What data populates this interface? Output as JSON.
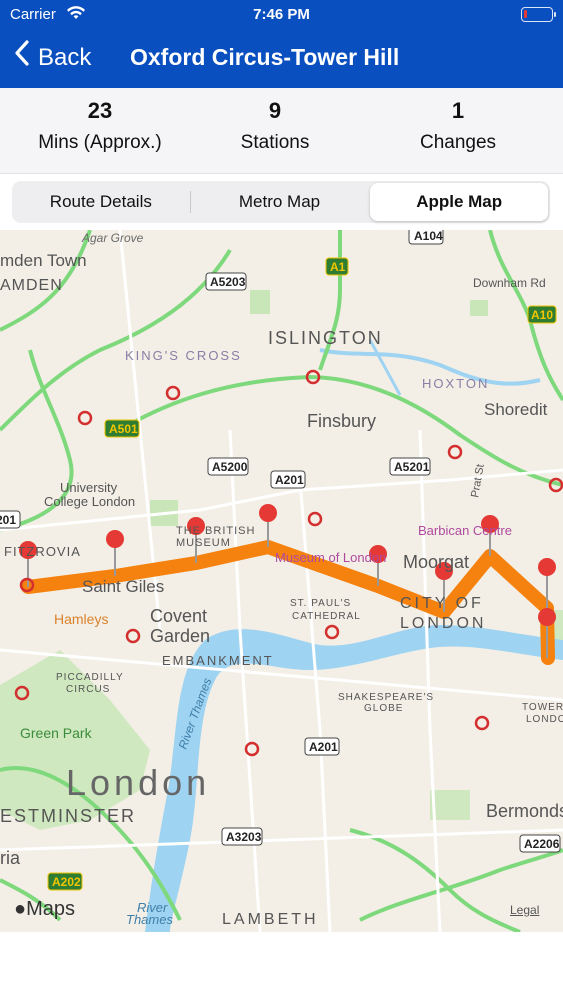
{
  "status": {
    "carrier": "Carrier",
    "time": "7:46 PM"
  },
  "nav": {
    "back_label": "Back",
    "title": "Oxford Circus-Tower Hill"
  },
  "stats": [
    {
      "value": "23",
      "label": "Mins (Approx.)"
    },
    {
      "value": "9",
      "label": "Stations"
    },
    {
      "value": "1",
      "label": "Changes"
    }
  ],
  "tabs": [
    {
      "label": "Route Details"
    },
    {
      "label": "Metro Map"
    },
    {
      "label": "Apple Map",
      "active": true
    }
  ],
  "map": {
    "places": [
      "mden Town",
      "AMDEN",
      "ISLINGTON",
      "KING'S CROSS",
      "HOXTON",
      "Shoredit",
      "Finsbury",
      "University",
      "College London",
      "THE BRITISH",
      "MUSEUM",
      "Barbican Centre",
      "FITZROVIA",
      "Saint Giles",
      "Museum of London",
      "Moorgat",
      "CITY OF",
      "LONDON",
      "ST. PAUL'S",
      "CATHEDRAL",
      "Hamleys",
      "Covent",
      "Garden",
      "EMBANKMENT",
      "PICCADILLY",
      "CIRCUS",
      "SHAKESPEARE'S",
      "GLOBE",
      "TOWER OF",
      "LONDON",
      "Green Park",
      "London",
      "ESTMINSTER",
      "Bermondse",
      "ria",
      "LAMBETH",
      "River Thames",
      "River",
      "Thames",
      "Agar Grove",
      "Downham Rd",
      "Prat St"
    ],
    "roads": [
      "A104",
      "A5203",
      "A1",
      "A10",
      "A501",
      "A5200",
      "A201",
      "A5201",
      "201",
      "A201",
      "A3203",
      "A2206",
      "A202"
    ],
    "attribution": "Maps",
    "legal": "Legal",
    "route_color": "#f5820f"
  }
}
